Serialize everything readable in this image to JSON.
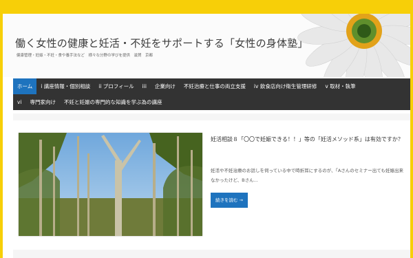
{
  "header": {
    "title": "働く女性の健康と妊活・不妊をサポートする「女性の身体塾」",
    "description": "健康管理・妊娠・不妊・食や養手法など　様々な分野の学びを提供　滋賀　京都"
  },
  "nav": {
    "row1": [
      "ホーム",
      "i 講座情報・個別相談",
      "ii プロフィール",
      "iii",
      "企業向け",
      "不妊治療と仕事の両立支援",
      "iv 飲食店向け衛生管理研修",
      "v 取材・執筆"
    ],
    "row2": [
      "vi",
      "専門家向け",
      "不妊と妊娠の専門的な知識を学ぶ為の講座"
    ]
  },
  "post": {
    "title": "妊活相談８「〇〇で妊娠できる！！」等の「妊活メソッド系」は有効ですか？",
    "excerpt": "妊活や不妊治療のお話しを伺っている中で時折耳にするのが、「Aさんのセミナー出ても妊娠出来なかったけど、Bさん...",
    "read_more": "続きを読む →"
  },
  "colors": {
    "border": "#f7cf08",
    "nav_bg": "#333333",
    "accent": "#1e73be"
  }
}
